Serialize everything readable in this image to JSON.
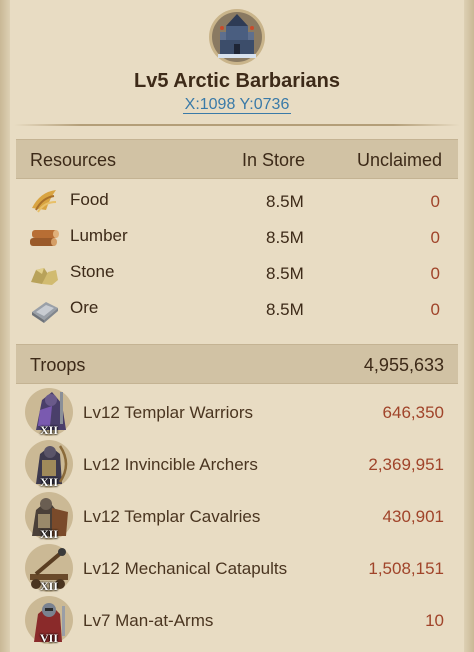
{
  "colors": {
    "background": "#e8dcc3",
    "header_band": "#d1c2a4",
    "coord_link": "#3a7aa8",
    "unclaimed_value": "#a0442a",
    "troop_count": "#a0442a"
  },
  "header": {
    "icon": "castle-icon",
    "title": "Lv5 Arctic Barbarians",
    "coords": "X:1098 Y:0736"
  },
  "resources": {
    "header": {
      "label": "Resources",
      "in_store": "In Store",
      "unclaimed": "Unclaimed"
    },
    "rows": [
      {
        "icon": "food-icon",
        "name": "Food",
        "in_store": "8.5M",
        "unclaimed": "0"
      },
      {
        "icon": "lumber-icon",
        "name": "Lumber",
        "in_store": "8.5M",
        "unclaimed": "0"
      },
      {
        "icon": "stone-icon",
        "name": "Stone",
        "in_store": "8.5M",
        "unclaimed": "0"
      },
      {
        "icon": "ore-icon",
        "name": "Ore",
        "in_store": "8.5M",
        "unclaimed": "0"
      }
    ]
  },
  "troops": {
    "header": {
      "label": "Troops",
      "total": "4,955,633"
    },
    "rows": [
      {
        "icon": "templar-warrior-icon",
        "tier": "XII",
        "name": "Lv12 Templar Warriors",
        "count": "646,350"
      },
      {
        "icon": "archer-icon",
        "tier": "XII",
        "name": "Lv12 Invincible Archers",
        "count": "2,369,951"
      },
      {
        "icon": "cavalry-icon",
        "tier": "XII",
        "name": "Lv12 Templar Cavalries",
        "count": "430,901"
      },
      {
        "icon": "catapult-icon",
        "tier": "XII",
        "name": "Lv12 Mechanical Catapults",
        "count": "1,508,151"
      },
      {
        "icon": "man-at-arms-icon",
        "tier": "VII",
        "name": "Lv7 Man-at-Arms",
        "count": "10"
      }
    ]
  }
}
